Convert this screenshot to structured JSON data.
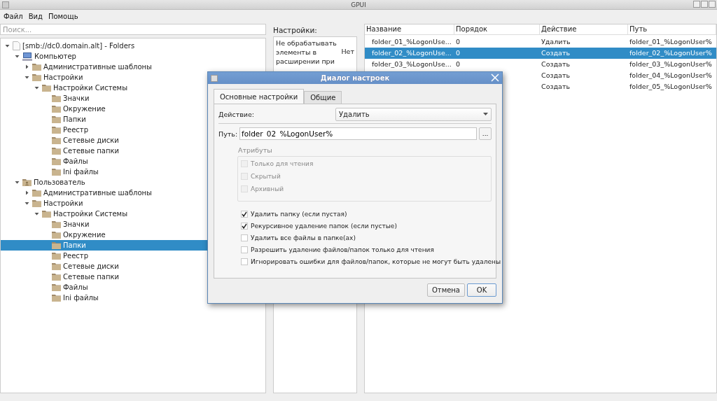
{
  "window": {
    "title": "GPUI"
  },
  "menu": [
    {
      "label": "Файл"
    },
    {
      "label": "Вид"
    },
    {
      "label": "Помощь"
    }
  ],
  "search": {
    "placeholder": "Поиск..."
  },
  "tree": [
    {
      "label": "[smb://dc0.domain.alt] - Folders",
      "kind": "document",
      "expanded": true,
      "selected": false,
      "children": [
        {
          "label": "Компьютер",
          "kind": "computer",
          "expanded": true,
          "selected": false,
          "children": [
            {
              "label": "Административные шаблоны",
              "kind": "folder",
              "expanded": false,
              "selected": false
            },
            {
              "label": "Настройки",
              "kind": "folder",
              "expanded": true,
              "selected": false,
              "children": [
                {
                  "label": "Настройки Системы",
                  "kind": "folder",
                  "expanded": true,
                  "selected": false,
                  "children": [
                    {
                      "label": "Значки",
                      "kind": "folder",
                      "selected": false
                    },
                    {
                      "label": "Окружение",
                      "kind": "folder",
                      "selected": false
                    },
                    {
                      "label": "Папки",
                      "kind": "folder",
                      "selected": false
                    },
                    {
                      "label": "Реестр",
                      "kind": "folder",
                      "selected": false
                    },
                    {
                      "label": "Сетевые диски",
                      "kind": "folder",
                      "selected": false
                    },
                    {
                      "label": "Сетевые папки",
                      "kind": "folder",
                      "selected": false
                    },
                    {
                      "label": "Файлы",
                      "kind": "folder",
                      "selected": false
                    },
                    {
                      "label": "Ini файлы",
                      "kind": "folder",
                      "selected": false
                    }
                  ]
                }
              ]
            }
          ]
        },
        {
          "label": "Пользователь",
          "kind": "user-folder",
          "expanded": true,
          "selected": false,
          "children": [
            {
              "label": "Административные шаблоны",
              "kind": "folder",
              "expanded": false,
              "selected": false
            },
            {
              "label": "Настройки",
              "kind": "folder",
              "expanded": true,
              "selected": false,
              "children": [
                {
                  "label": "Настройки Системы",
                  "kind": "folder",
                  "expanded": true,
                  "selected": false,
                  "children": [
                    {
                      "label": "Значки",
                      "kind": "folder",
                      "selected": false
                    },
                    {
                      "label": "Окружение",
                      "kind": "folder",
                      "selected": false
                    },
                    {
                      "label": "Папки",
                      "kind": "folder",
                      "selected": true
                    },
                    {
                      "label": "Реестр",
                      "kind": "folder",
                      "selected": false
                    },
                    {
                      "label": "Сетевые диски",
                      "kind": "folder",
                      "selected": false
                    },
                    {
                      "label": "Сетевые папки",
                      "kind": "folder",
                      "selected": false
                    },
                    {
                      "label": "Файлы",
                      "kind": "folder",
                      "selected": false
                    },
                    {
                      "label": "Ini файлы",
                      "kind": "folder",
                      "selected": false
                    }
                  ]
                }
              ]
            }
          ]
        }
      ]
    }
  ],
  "settings_panel": {
    "title": "Настройки:",
    "rows": [
      {
        "name": "Не обрабатывать элементы в расширении при",
        "value": "Нет"
      }
    ]
  },
  "table": {
    "columns": [
      "Название",
      "Порядок",
      "Действие",
      "Путь"
    ],
    "rows": [
      {
        "name": "folder_01_%LogonUse...",
        "order": "0",
        "action": "Удалить",
        "path": "folder_01_%LogonUser%",
        "selected": false
      },
      {
        "name": "folder_02_%LogonUse...",
        "order": "0",
        "action": "Создать",
        "path": "folder_02_%LogonUser%",
        "selected": true
      },
      {
        "name": "folder_03_%LogonUse...",
        "order": "0",
        "action": "Создать",
        "path": "folder_03_%LogonUser%",
        "selected": false
      },
      {
        "action": "Создать",
        "path": "folder_04_%LogonUser%",
        "selected": false
      },
      {
        "action": "Создать",
        "path": "folder_05_%LogonUser%",
        "selected": false
      }
    ]
  },
  "dialog": {
    "title": "Диалог настроек",
    "tabs": [
      {
        "label": "Основные настройки",
        "selected": true
      },
      {
        "label": "Общие",
        "selected": false
      }
    ],
    "action": {
      "label": "Действие:",
      "value": "Удалить"
    },
    "path": {
      "label": "Путь:",
      "value": "folder_02_%LogonUser%",
      "browse": "..."
    },
    "attributes": {
      "title": "Атрибуты",
      "disabled": true,
      "items": [
        {
          "label": "Только для чтения",
          "checked": false
        },
        {
          "label": "Скрытый",
          "checked": false
        },
        {
          "label": "Архивный",
          "checked": false
        }
      ]
    },
    "options": [
      {
        "label": "Удалить папку (если пустая)",
        "checked": true
      },
      {
        "label": "Рекурсивное удаление папок (если пустые)",
        "checked": true
      },
      {
        "label": "Удалить все файлы в папке(ах)",
        "checked": false
      },
      {
        "label": "Разрешить удаление файлов/папок только для чтения",
        "checked": false
      },
      {
        "label": "Игнорировать ошибки для файлов/папок, которые не могут быть удалены",
        "checked": false
      }
    ],
    "buttons": [
      {
        "label": "Отмена",
        "default": false
      },
      {
        "label": "OK",
        "default": true
      }
    ]
  }
}
